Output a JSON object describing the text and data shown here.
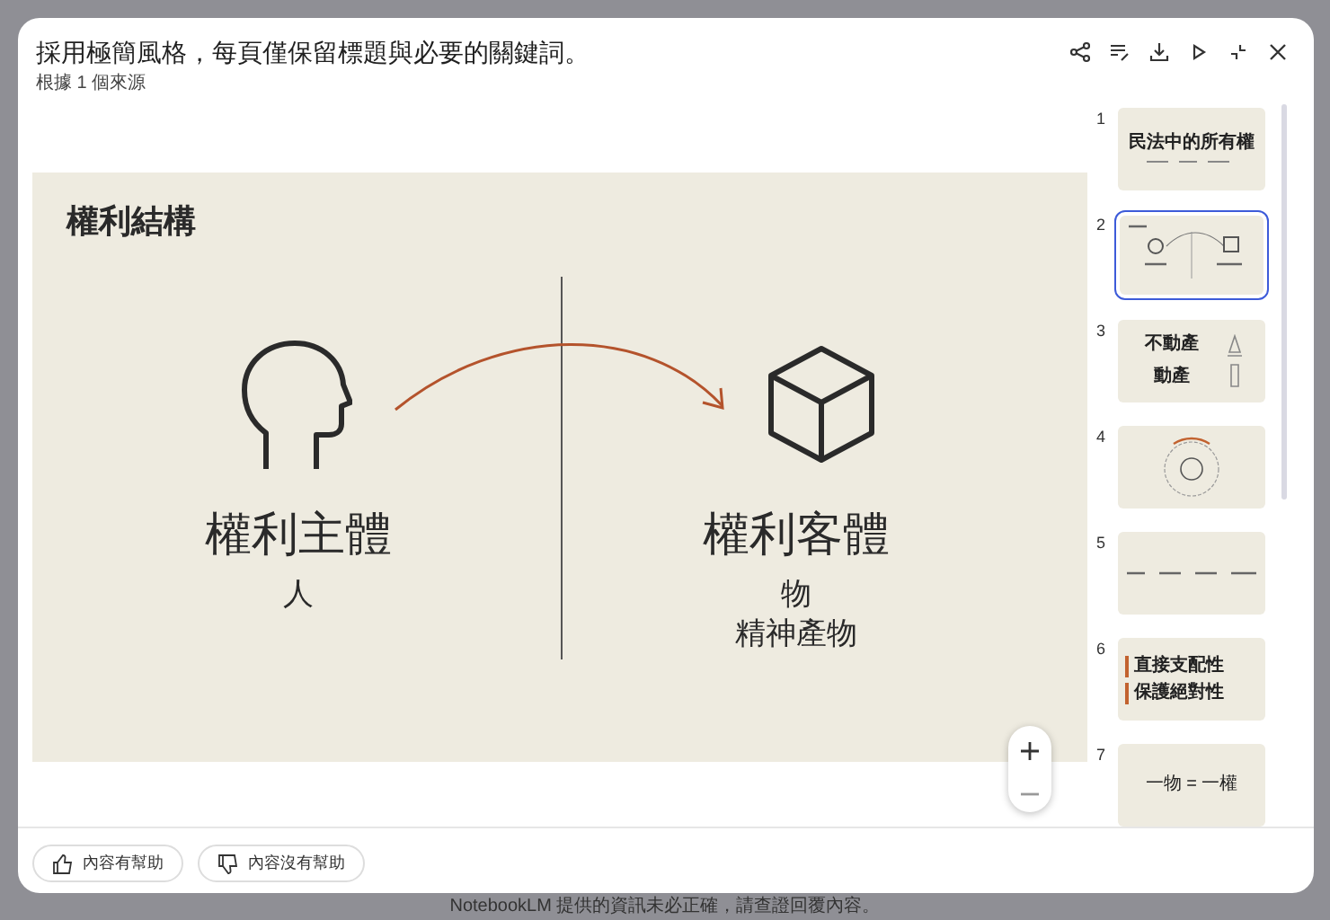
{
  "dialog": {
    "title": "採用極簡風格，每頁僅保留標題與必要的關鍵詞。",
    "subtitle": "根據 1 個來源"
  },
  "slide": {
    "title": "權利結構",
    "left": {
      "heading": "權利主體",
      "items": [
        "人"
      ]
    },
    "right": {
      "heading": "權利客體",
      "items": [
        "物",
        "精神產物"
      ]
    }
  },
  "thumbnails": [
    {
      "number": "1",
      "kind": "title",
      "selected": false,
      "texts": [
        "民法中的所有權"
      ]
    },
    {
      "number": "2",
      "kind": "structure",
      "selected": true
    },
    {
      "number": "3",
      "kind": "split",
      "selected": false,
      "texts": [
        "不動產",
        "動產"
      ]
    },
    {
      "number": "4",
      "kind": "cycle",
      "selected": false
    },
    {
      "number": "5",
      "kind": "flow",
      "selected": false
    },
    {
      "number": "6",
      "kind": "pillars",
      "selected": false,
      "texts": [
        "直接支配性",
        "保護絕對性"
      ]
    },
    {
      "number": "7",
      "kind": "equation",
      "selected": false,
      "texts": [
        "一物 = 一權"
      ]
    }
  ],
  "feedback": [
    "內容有幫助",
    "內容沒有幫助"
  ],
  "footer": "NotebookLM 提供的資訊未必正確，請查證回覆內容。"
}
